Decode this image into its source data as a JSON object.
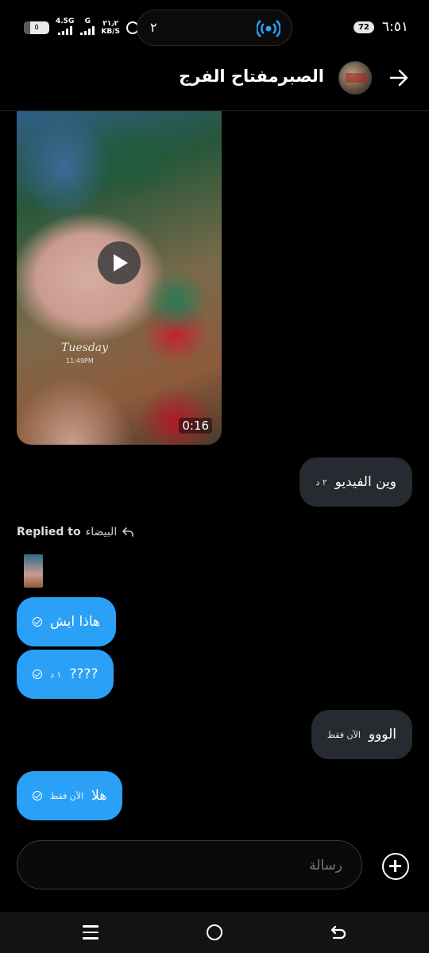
{
  "status_bar": {
    "battery_left": "٥",
    "network_type": "4.5G",
    "network_g": "G",
    "speed_value": "٢١٫٢",
    "speed_unit": "KB/S",
    "island_text": "٢",
    "battery_right": "72",
    "clock": "٦:٥١"
  },
  "header": {
    "contact_name": "الصبرمفتاح الفرج",
    "back_icon": "arrow-right-icon",
    "avatar_icon": "avatar"
  },
  "video": {
    "watermark": "Tuesday",
    "watermark_time": "11:49PM",
    "duration": "0:16"
  },
  "messages": [
    {
      "direction": "received",
      "text": "وين الفيديو",
      "meta": "٢ د"
    },
    {
      "direction": "sent",
      "text": "هاذا ايش",
      "meta": ""
    },
    {
      "direction": "sent",
      "text": "????",
      "meta": "١ د"
    },
    {
      "direction": "received",
      "text": "الووو",
      "meta": "الآن فقط"
    },
    {
      "direction": "sent",
      "text": "هلا",
      "meta": "الآن فقط"
    }
  ],
  "reply": {
    "label": "Replied to",
    "target": "البيضاء",
    "icon": "reply-arrow-icon"
  },
  "composer": {
    "placeholder": "رسالة",
    "add_icon": "plus-circle-icon"
  },
  "nav": {
    "menu_icon": "menu-icon",
    "home_icon": "home-circle-icon",
    "back_icon": "back-icon"
  },
  "colors": {
    "sent_bubble": "#2aa1f7",
    "received_bubble": "#262b31",
    "background": "#000000"
  }
}
